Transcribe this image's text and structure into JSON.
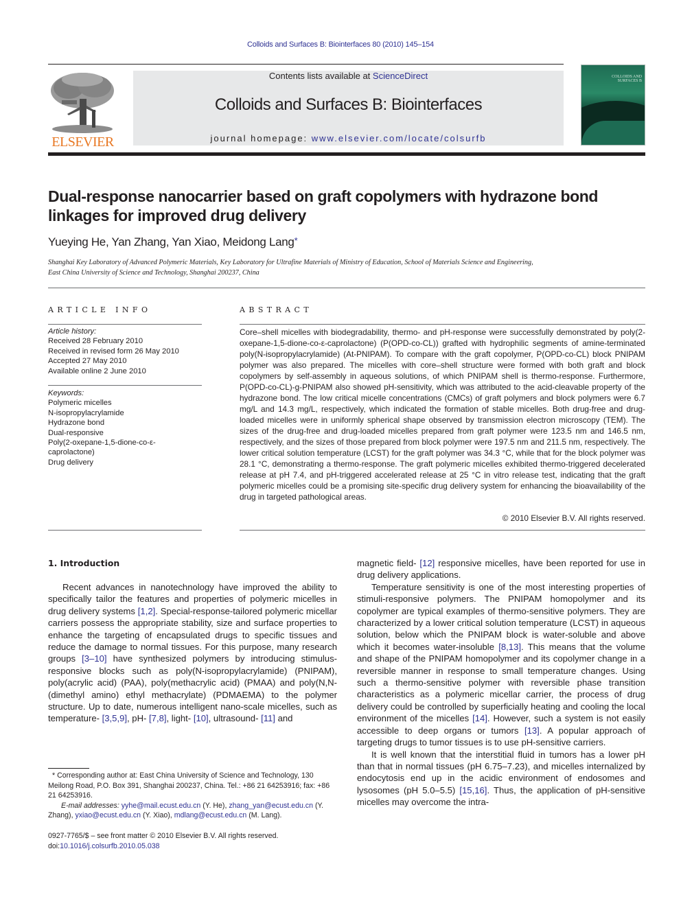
{
  "running_head": "Colloids and Surfaces B: Biointerfaces 80 (2010) 145–154",
  "masthead": {
    "publisher_logo_text": "ELSEVIER",
    "contents_prefix": "Contents lists available at ",
    "contents_link": "ScienceDirect",
    "journal_title": "Colloids and Surfaces B: Biointerfaces",
    "homepage_prefix": "journal homepage: ",
    "homepage_link": "www.elsevier.com/locate/colsurfb",
    "cover_title": "COLLOIDS AND SURFACES B"
  },
  "article": {
    "title": "Dual-response nanocarrier based on graft copolymers with hydrazone bond linkages for improved drug delivery",
    "authors": "Yueying He, Yan Zhang, Yan Xiao, Meidong Lang",
    "corresponding_marker": "*",
    "affiliation_line1": "Shanghai Key Laboratory of Advanced Polymeric Materials, Key Laboratory for Ultrafine Materials of Ministry of Education, School of Materials Science and Engineering,",
    "affiliation_line2": "East China University of Science and Technology, Shanghai 200237, China"
  },
  "article_info": {
    "heading": "ARTICLE INFO",
    "history_label": "Article history:",
    "history": [
      "Received 28 February 2010",
      "Received in revised form 26 May 2010",
      "Accepted 27 May 2010",
      "Available online 2 June 2010"
    ],
    "keywords_label": "Keywords:",
    "keywords": [
      "Polymeric micelles",
      "N-isopropylacrylamide",
      "Hydrazone bond",
      "Dual-responsive",
      "Poly(2-oxepane-1,5-dione-co-ε-caprolactone)",
      "Drug delivery"
    ]
  },
  "abstract": {
    "heading": "ABSTRACT",
    "text": "Core–shell micelles with biodegradability, thermo- and pH-response were successfully demonstrated by poly(2-oxepane-1,5-dione-co-ε-caprolactone) (P(OPD-co-CL)) grafted with hydrophilic segments of amine-terminated poly(N-isopropylacrylamide) (At-PNIPAM). To compare with the graft copolymer, P(OPD-co-CL) block PNIPAM polymer was also prepared. The micelles with core–shell structure were formed with both graft and block copolymers by self-assembly in aqueous solutions, of which PNIPAM shell is thermo-response. Furthermore, P(OPD-co-CL)-g-PNIPAM also showed pH-sensitivity, which was attributed to the acid-cleavable property of the hydrazone bond. The low critical micelle concentrations (CMCs) of graft polymers and block polymers were 6.7 mg/L and 14.3 mg/L, respectively, which indicated the formation of stable micelles. Both drug-free and drug-loaded micelles were in uniformly spherical shape observed by transmission electron microscopy (TEM). The sizes of the drug-free and drug-loaded micelles prepared from graft polymer were 123.5 nm and 146.5 nm, respectively, and the sizes of those prepared from block polymer were 197.5 nm and 211.5 nm, respectively. The lower critical solution temperature (LCST) for the graft polymer was 34.3 °C, while that for the block polymer was 28.1 °C, demonstrating a thermo-response. The graft polymeric micelles exhibited thermo-triggered decelerated release at pH 7.4, and pH-triggered accelerated release at 25 °C in vitro release test, indicating that the graft polymeric micelles could be a promising site-specific drug delivery system for enhancing the bioavailability of the drug in targeted pathological areas.",
    "copyright": "© 2010 Elsevier B.V. All rights reserved."
  },
  "introduction": {
    "heading": "1.  Introduction",
    "left_paragraph": [
      {
        "t": "Recent advances in nanotechnology have improved the ability to specifically tailor the features and properties of polymeric micelles in drug delivery systems "
      },
      {
        "ref": "[1,2]"
      },
      {
        "t": ". Special-response-tailored polymeric micellar carriers possess the appropriate stability, size and surface properties to enhance the targeting of encapsulated drugs to specific tissues and reduce the damage to normal tissues. For this purpose, many research groups "
      },
      {
        "ref": "[3–10]"
      },
      {
        "t": " have synthesized polymers by introducing stimulus-responsive blocks such as poly(N-isopropylacrylamide) (PNIPAM), poly(acrylic acid) (PAA), poly(methacrylic acid) (PMAA) and poly(N,N-(dimethyl amino) ethyl methacrylate) (PDMAEMA) to the polymer structure. Up to date, numerous intelligent nano-scale micelles, such as temperature- "
      },
      {
        "ref": "[3,5,9]"
      },
      {
        "t": ", pH- "
      },
      {
        "ref": "[7,8]"
      },
      {
        "t": ", light- "
      },
      {
        "ref": "[10]"
      },
      {
        "t": ", ultrasound- "
      },
      {
        "ref": "[11]"
      },
      {
        "t": " and"
      }
    ],
    "right_paragraphs": [
      [
        {
          "t": "magnetic field- "
        },
        {
          "ref": "[12]"
        },
        {
          "t": " responsive micelles, have been reported for use in drug delivery applications."
        }
      ],
      [
        {
          "t": "Temperature sensitivity is one of the most interesting properties of stimuli-responsive polymers. The PNIPAM homopolymer and its copolymer are typical examples of thermo-sensitive polymers. They are characterized by a lower critical solution temperature (LCST) in aqueous solution, below which the PNIPAM block is water-soluble and above which it becomes water-insoluble "
        },
        {
          "ref": "[8,13]"
        },
        {
          "t": ". This means that the volume and shape of the PNIPAM homopolymer and its copolymer change in a reversible manner in response to small temperature changes. Using such a thermo-sensitive polymer with reversible phase transition characteristics as a polymeric micellar carrier, the process of drug delivery could be controlled by superficially heating and cooling the local environment of the micelles "
        },
        {
          "ref": "[14]"
        },
        {
          "t": ". However, such a system is not easily accessible to deep organs or tumors "
        },
        {
          "ref": "[13]"
        },
        {
          "t": ". A popular approach of targeting drugs to tumor tissues is to use pH-sensitive carriers."
        }
      ],
      [
        {
          "t": "It is well known that the interstitial fluid in tumors has a lower pH than that in normal tissues (pH 6.75–7.23), and micelles internalized by endocytosis end up in the acidic environment of endosomes and lysosomes (pH 5.0–5.5) "
        },
        {
          "ref": "[15,16]"
        },
        {
          "t": ". Thus, the application of pH-sensitive micelles may overcome the intra-"
        }
      ]
    ]
  },
  "footnotes": {
    "corresponding": "* Corresponding author at: East China University of Science and Technology, 130 Meilong Road, P.O. Box 391, Shanghai 200237, China. Tel.: +86 21 64253916; fax: +86 21 64253916.",
    "email_label": "E-mail addresses: ",
    "emails": [
      {
        "address": "yyhe@mail.ecust.edu.cn",
        "who": " (Y. He), "
      },
      {
        "address": "zhang_yan@ecust.edu.cn",
        "who": " (Y. Zhang), "
      },
      {
        "address": "yxiao@ecust.edu.cn",
        "who": " (Y. Xiao), "
      },
      {
        "address": "mdlang@ecust.edu.cn",
        "who": " (M. Lang)."
      }
    ]
  },
  "front_matter": {
    "issn_line": "0927-7765/$ – see front matter © 2010 Elsevier B.V. All rights reserved.",
    "doi_prefix": "doi:",
    "doi": "10.1016/j.colsurfb.2010.05.038"
  },
  "colors": {
    "link": "#2e3192",
    "elsevier_orange": "#e87722",
    "masthead_bg": "#e7e8e9"
  }
}
